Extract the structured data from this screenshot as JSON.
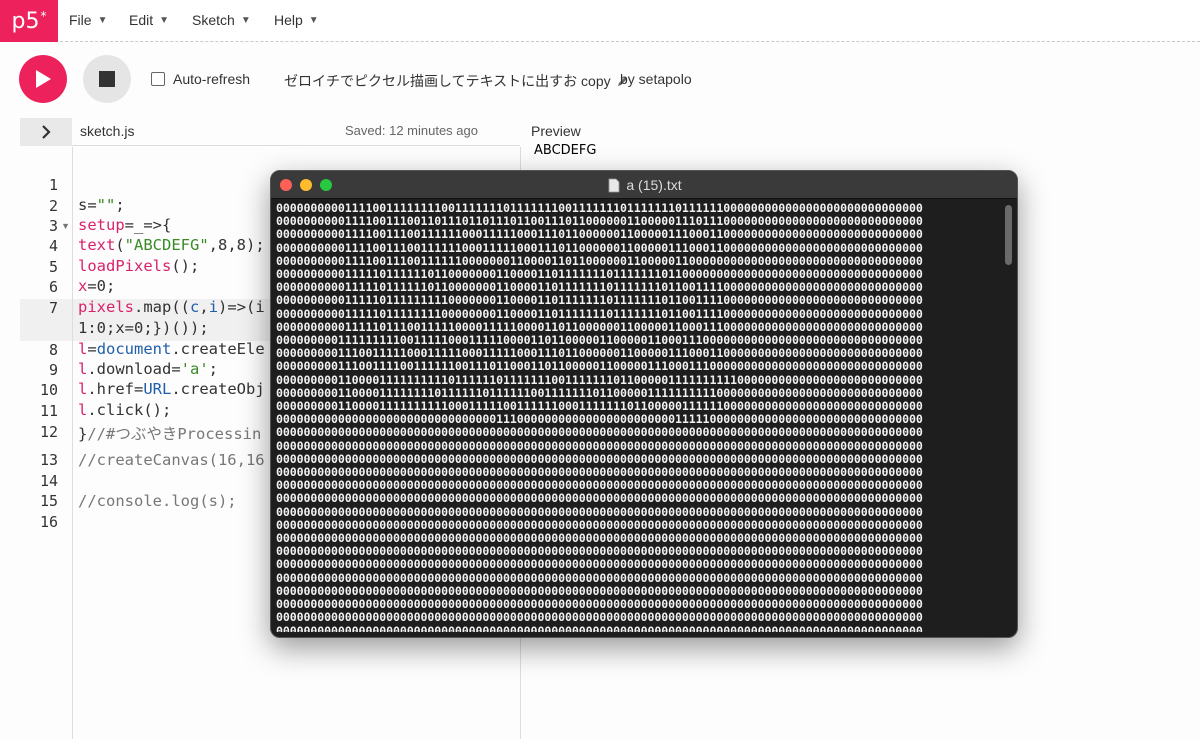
{
  "nav": {
    "logo": "p5",
    "logo_sup": "*",
    "menus": [
      "File",
      "Edit",
      "Sketch",
      "Help"
    ]
  },
  "toolbar": {
    "auto_refresh_label": "Auto-refresh",
    "sketch_name": "ゼロイチでピクセル描画してテキストに出すお copy",
    "byline": "by setapolo"
  },
  "editor": {
    "filename": "sketch.js",
    "saved_status": "Saved: 12 minutes ago",
    "line_numbers": [
      "1",
      "2",
      "3",
      "4",
      "5",
      "6",
      "7",
      "8",
      "9",
      "10",
      "11",
      "12",
      "13",
      "14",
      "15",
      "16"
    ]
  },
  "preview": {
    "label": "Preview",
    "canvas_text": "ABCDEFG"
  },
  "file_window": {
    "title": "a (15).txt",
    "lines": [
      "0000000000111100111111110011111110111111100111111101111111011111100000000000000000000000000000",
      "0000000000111100111001101110110111011001110110000001100000111011100000000000000000000000000000",
      "0000000000111100111001111110001111100011101100000011000001110001100000000000000000000000000000",
      "0000000000111100111001111110001111100011101100000011000001110001100000000000000000000000000000",
      "0000000000111100111001111110000000110000110110000001100000110000000000000000000000000000000000",
      "0000000000111110111111011000000011000011011111110111111101100000000000000000000000000000000000",
      "0000000000111110111111011000000011000011011111110111111101100111100000000000000000000000000000",
      "0000000000111110111111111000000011000011011111110111111101100111100000000000000000000000000000",
      "0000000000111110111111110000000011000011011111110111111101100111100000000000000000000000000000",
      "0000000000111110111001111100001111100001101100000011000001100011100000000000000000000000000000",
      "0000000001111111110011111000111110000110110000011000001100011100000000000000000000000000000000",
      "0000000001110011111000111110001111100011101100000011000001110001100000000000000000000000000000",
      "0000000001110011110011111100111011000110110000011000001110001110000000000000000000000000000000",
      "0000000001100001111111111011111101111111001111111011000001111111111000000000000000000000000000",
      "0000000001100001111111101111110111111001111111011000001111111111000000000000000000000000000000",
      "0000000001100001111111111000111110011111100011111110110000011111100000000000000000000000000000",
      "0000000000000000000000000000000011100000000000000000000000111110000000000000000000000000000000",
      "0000000000000000000000000000000000000000000000000000000000000000000000000000000000000000000000",
      "0000000000000000000000000000000000000000000000000000000000000000000000000000000000000000000000",
      "0000000000000000000000000000000000000000000000000000000000000000000000000000000000000000000000",
      "0000000000000000000000000000000000000000000000000000000000000000000000000000000000000000000000",
      "0000000000000000000000000000000000000000000000000000000000000000000000000000000000000000000000",
      "0000000000000000000000000000000000000000000000000000000000000000000000000000000000000000000000",
      "0000000000000000000000000000000000000000000000000000000000000000000000000000000000000000000000",
      "0000000000000000000000000000000000000000000000000000000000000000000000000000000000000000000000",
      "0000000000000000000000000000000000000000000000000000000000000000000000000000000000000000000000",
      "0000000000000000000000000000000000000000000000000000000000000000000000000000000000000000000000",
      "0000000000000000000000000000000000000000000000000000000000000000000000000000000000000000000000",
      "0000000000000000000000000000000000000000000000000000000000000000000000000000000000000000000000",
      "0000000000000000000000000000000000000000000000000000000000000000000000000000000000000000000000",
      "0000000000000000000000000000000000000000000000000000000000000000000000000000000000000000000000",
      "0000000000000000000000000000000000000000000000000000000000000000000000000000000000000000000000",
      "0000000000000000000000000000000000000000000000000000000000000000000000000000000000000000000000"
    ]
  }
}
